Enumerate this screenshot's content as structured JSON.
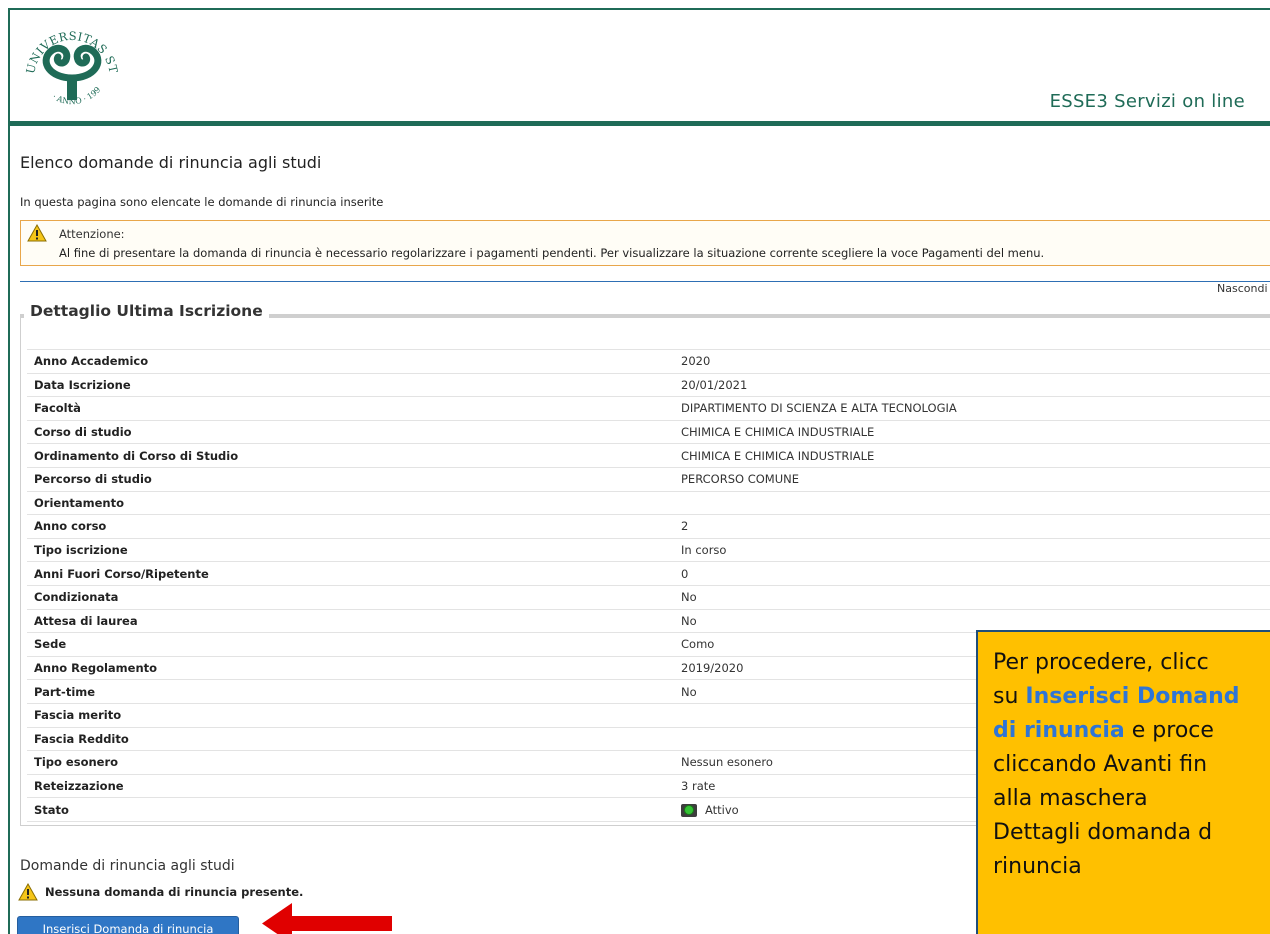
{
  "header": {
    "logo_alt": "UNIVERSITAS STUDIORUM INSUBRIAE",
    "service_title": "ESSE3 Servizi on line"
  },
  "page": {
    "title": "Elenco domande di rinuncia agli studi",
    "intro": "In questa pagina sono elencate le domande di rinuncia inserite"
  },
  "warning": {
    "title": "Attenzione:",
    "text": "Al fine di presentare la domanda di rinuncia è necessario regolarizzare i pagamenti pendenti. Per visualizzare la situazione corrente scegliere la voce Pagamenti del menu."
  },
  "hide_link": "Nascondi d",
  "details": {
    "legend": "Dettaglio Ultima Iscrizione",
    "rows": [
      {
        "label": "Anno Accademico",
        "value": "2020"
      },
      {
        "label": "Data Iscrizione",
        "value": "20/01/2021"
      },
      {
        "label": "Facoltà",
        "value": "DIPARTIMENTO DI SCIENZA E ALTA TECNOLOGIA"
      },
      {
        "label": "Corso di studio",
        "value": "CHIMICA E CHIMICA INDUSTRIALE"
      },
      {
        "label": "Ordinamento di Corso di Studio",
        "value": "CHIMICA E CHIMICA INDUSTRIALE"
      },
      {
        "label": "Percorso di studio",
        "value": "PERCORSO COMUNE"
      },
      {
        "label": "Orientamento",
        "value": ""
      },
      {
        "label": "Anno corso",
        "value": "2"
      },
      {
        "label": "Tipo iscrizione",
        "value": "In corso"
      },
      {
        "label": "Anni Fuori Corso/Ripetente",
        "value": "0"
      },
      {
        "label": "Condizionata",
        "value": "No"
      },
      {
        "label": "Attesa di laurea",
        "value": "No"
      },
      {
        "label": "Sede",
        "value": "Como"
      },
      {
        "label": "Anno Regolamento",
        "value": "2019/2020"
      },
      {
        "label": "Part-time",
        "value": "No"
      },
      {
        "label": "Fascia merito",
        "value": ""
      },
      {
        "label": "Fascia Reddito",
        "value": ""
      },
      {
        "label": "Tipo esonero",
        "value": "Nessun esonero"
      },
      {
        "label": "Reteizzazione",
        "value": "3 rate"
      },
      {
        "label": "Stato",
        "value": "Attivo",
        "status_color": "#34c234"
      }
    ]
  },
  "requests": {
    "title": "Domande di rinuncia agli studi",
    "empty_message": "Nessuna domanda di rinuncia presente.",
    "insert_button": "Inserisci Domanda di rinuncia"
  },
  "callout": {
    "lines": [
      "Per procedere, clicc",
      "su ",
      "Inserisci Domand",
      "di rinuncia",
      " e proce",
      "cliccando Avanti fin",
      "alla maschera",
      "Dettagli domanda d",
      "rinuncia"
    ]
  },
  "colors": {
    "brand_green": "#1f6b57",
    "button_blue": "#2f76c5",
    "callout_bg": "#ffc000",
    "callout_highlight": "#2f75d6",
    "warning_border": "#e8a64a",
    "arrow_red": "#e00000"
  }
}
